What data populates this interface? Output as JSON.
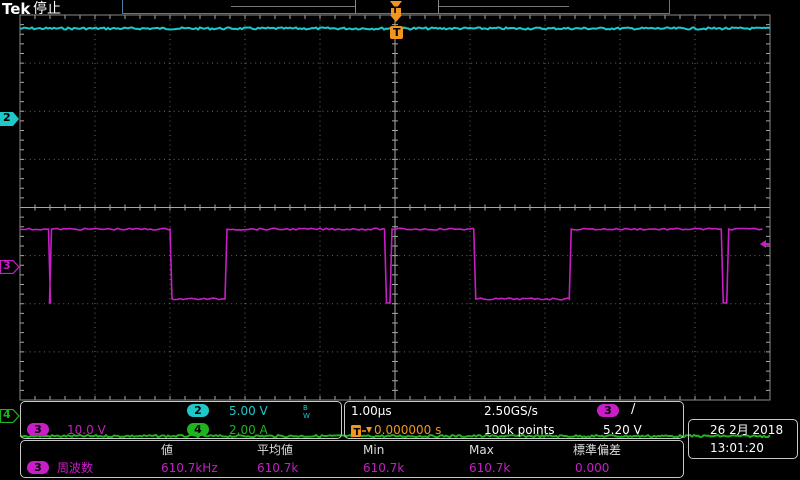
{
  "header": {
    "brand": "Tek",
    "status": "停止"
  },
  "colors": {
    "ch2": "#1ec8c8",
    "ch3": "#c81ec8",
    "ch4": "#1eb41e",
    "trigger": "#f0961e",
    "grid": "#6a6a6a",
    "bezel": "#4a7ca6"
  },
  "trigger": {
    "marker_label": "T",
    "position_label": "T"
  },
  "channel_markers": {
    "ch2": "2",
    "ch3": "3",
    "ch4": "4"
  },
  "waveform": {
    "ch3_pulse_high_spans_div": [
      [
        0,
        0.38
      ],
      [
        0.42,
        2.0
      ],
      [
        2.76,
        4.86
      ],
      [
        4.96,
        6.05
      ],
      [
        7.35,
        9.35
      ],
      [
        9.45,
        9.9
      ]
    ],
    "ch3_high_level_div": 4.45,
    "ch3_low_level_div": 5.9,
    "ch2_level_div": 0.28,
    "ch4_level_div": 8.75
  },
  "channels": {
    "ch3": {
      "num": "3",
      "scale": "10.0 V"
    },
    "ch2": {
      "num": "2",
      "scale": "5.00 V",
      "bw": "B W"
    },
    "ch4": {
      "num": "4",
      "scale": "2.00 A"
    }
  },
  "timebase": {
    "time_div": "1.00µs",
    "sample_rate": "2.50GS/s",
    "trigger_delay": "0.000000 s",
    "record_length": "100k points",
    "trigger_channel": "3",
    "trigger_slope": "/",
    "trigger_level": "5.20 V"
  },
  "measurement": {
    "headers": [
      "値",
      "平均値",
      "Min",
      "Max",
      "標準偏差"
    ],
    "channel": "3",
    "name": "周波数",
    "values": [
      "610.7kHz",
      "610.7k",
      "610.7k",
      "610.7k",
      "0.000"
    ]
  },
  "datetime": {
    "date": "26 2月 2018",
    "time": "13:01:20"
  }
}
